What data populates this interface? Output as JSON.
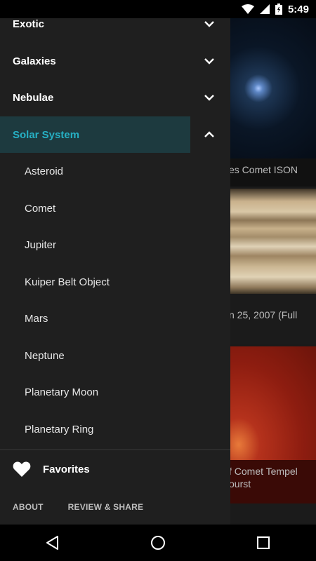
{
  "status": {
    "time": "5:49",
    "icons": [
      "wifi-icon",
      "signal-icon",
      "battery-icon"
    ]
  },
  "drawer": {
    "categories": [
      {
        "label": "Exotic",
        "expanded": false
      },
      {
        "label": "Galaxies",
        "expanded": false
      },
      {
        "label": "Nebulae",
        "expanded": false
      },
      {
        "label": "Solar System",
        "expanded": true
      }
    ],
    "subitems": [
      "Asteroid",
      "Comet",
      "Jupiter",
      "Kuiper Belt Object",
      "Mars",
      "Neptune",
      "Planetary Moon",
      "Planetary Ring"
    ],
    "favorites_label": "Favorites",
    "footer": {
      "about": "ABOUT",
      "review": "REVIEW & SHARE"
    }
  },
  "background_cards": {
    "card1_caption": "es Comet ISON",
    "card2_caption": "n 25, 2007 (Full",
    "card3_caption_line1": "f Comet Tempel",
    "card3_caption_line2": "ourst"
  },
  "colors": {
    "accent": "#26b0c4",
    "active_bg": "#1d3a3f",
    "drawer_bg": "#1f1f1f"
  },
  "navbar": {
    "icons": [
      "back-icon",
      "home-icon",
      "recents-icon"
    ]
  }
}
